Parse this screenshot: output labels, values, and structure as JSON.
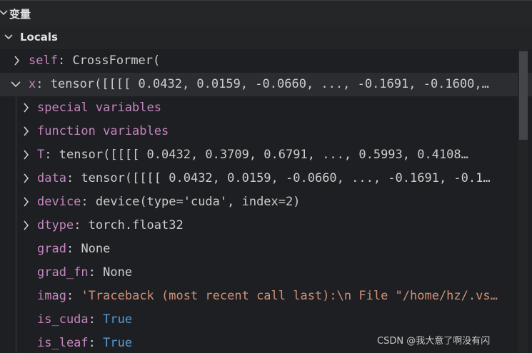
{
  "panel": {
    "title": "变量",
    "scope_label": "Locals"
  },
  "rows": [
    {
      "key": "self",
      "value": "CrossFormer(",
      "expanded": false
    },
    {
      "key": "x",
      "value": "tensor([[[[ 0.0432,  0.0159, -0.0660,  ..., -0.1691, -0.1600,…",
      "expanded": true
    },
    {
      "key": "special variables",
      "value": "",
      "expanded": false
    },
    {
      "key": "function variables",
      "value": "",
      "expanded": false
    },
    {
      "key": "T",
      "value": "tensor([[[[ 0.0432,  0.3709,  0.6791,  ...,  0.5993,  0.4108…",
      "expanded": false
    },
    {
      "key": "data",
      "value": "tensor([[[[ 0.0432,  0.0159, -0.0660,  ..., -0.1691, -0.1…",
      "expanded": false
    },
    {
      "key": "device",
      "value": "device(type='cuda', index=2)",
      "expanded": false
    },
    {
      "key": "dtype",
      "value": "torch.float32",
      "expanded": false
    },
    {
      "key": "grad",
      "value": "None"
    },
    {
      "key": "grad_fn",
      "value": "None"
    },
    {
      "key": "imag",
      "value": "'Traceback (most recent call last):\\n  File \"/home/hz/.vs…"
    },
    {
      "key": "is_cuda",
      "value": "True"
    },
    {
      "key": "is_leaf",
      "value": "True"
    }
  ],
  "watermark": "CSDN @我大意了啊没有闪",
  "icons": {
    "collapsed": "chevron-right-icon",
    "expanded": "chevron-down-icon"
  },
  "colors": {
    "background": "#1e1f22",
    "key": "#c586c0",
    "string": "#ce9178",
    "boolean": "#569cd6",
    "text": "#cccccc"
  }
}
